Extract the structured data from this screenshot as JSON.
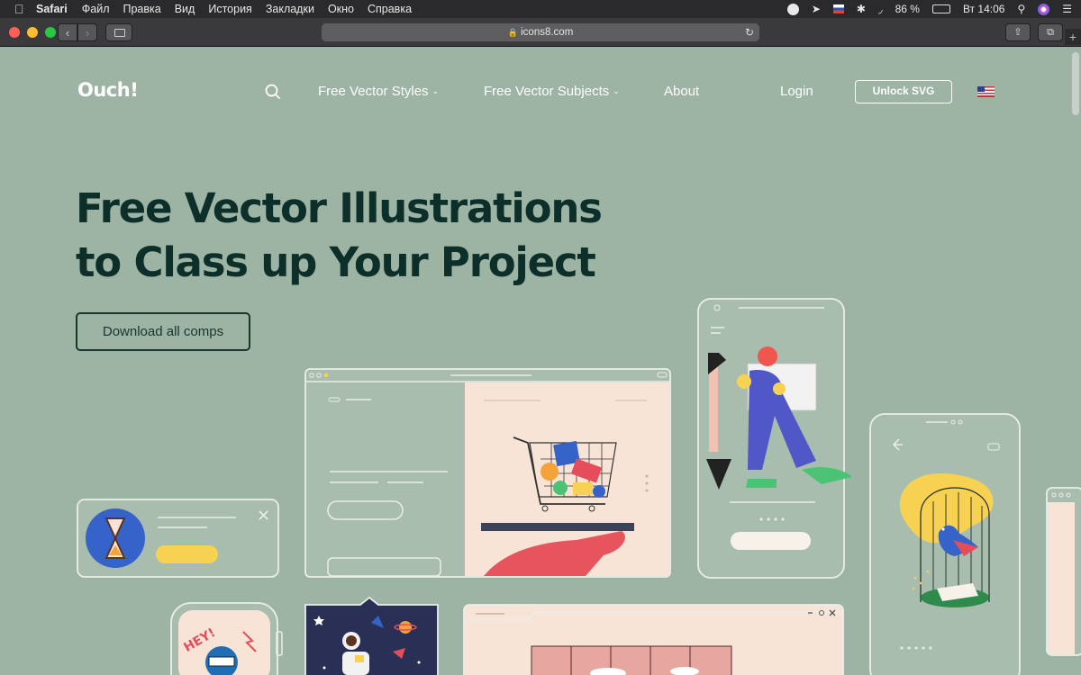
{
  "menubar": {
    "app": "Safari",
    "items": [
      "Файл",
      "Правка",
      "Вид",
      "История",
      "Закладки",
      "Окно",
      "Справка"
    ],
    "battery": "86 %",
    "clock": "Вт 14:06"
  },
  "browser": {
    "url": "icons8.com"
  },
  "site": {
    "logo": "Ouch!",
    "nav": {
      "styles": "Free Vector Styles",
      "subjects": "Free Vector Subjects",
      "about": "About",
      "login": "Login",
      "unlock": "Unlock SVG"
    },
    "hero": {
      "line1": "Free Vector Illustrations",
      "line2": "to Class up Your Project",
      "cta": "Download all comps"
    },
    "stickers": {
      "hey": "HEY!"
    }
  },
  "colors": {
    "page_bg": "#9db3a4",
    "heading": "#0d2f29",
    "card_outline": "#e9efe9",
    "card_fill": "#a9bdaf",
    "peach": "#f8e4d6",
    "yellow": "#f7d152"
  }
}
